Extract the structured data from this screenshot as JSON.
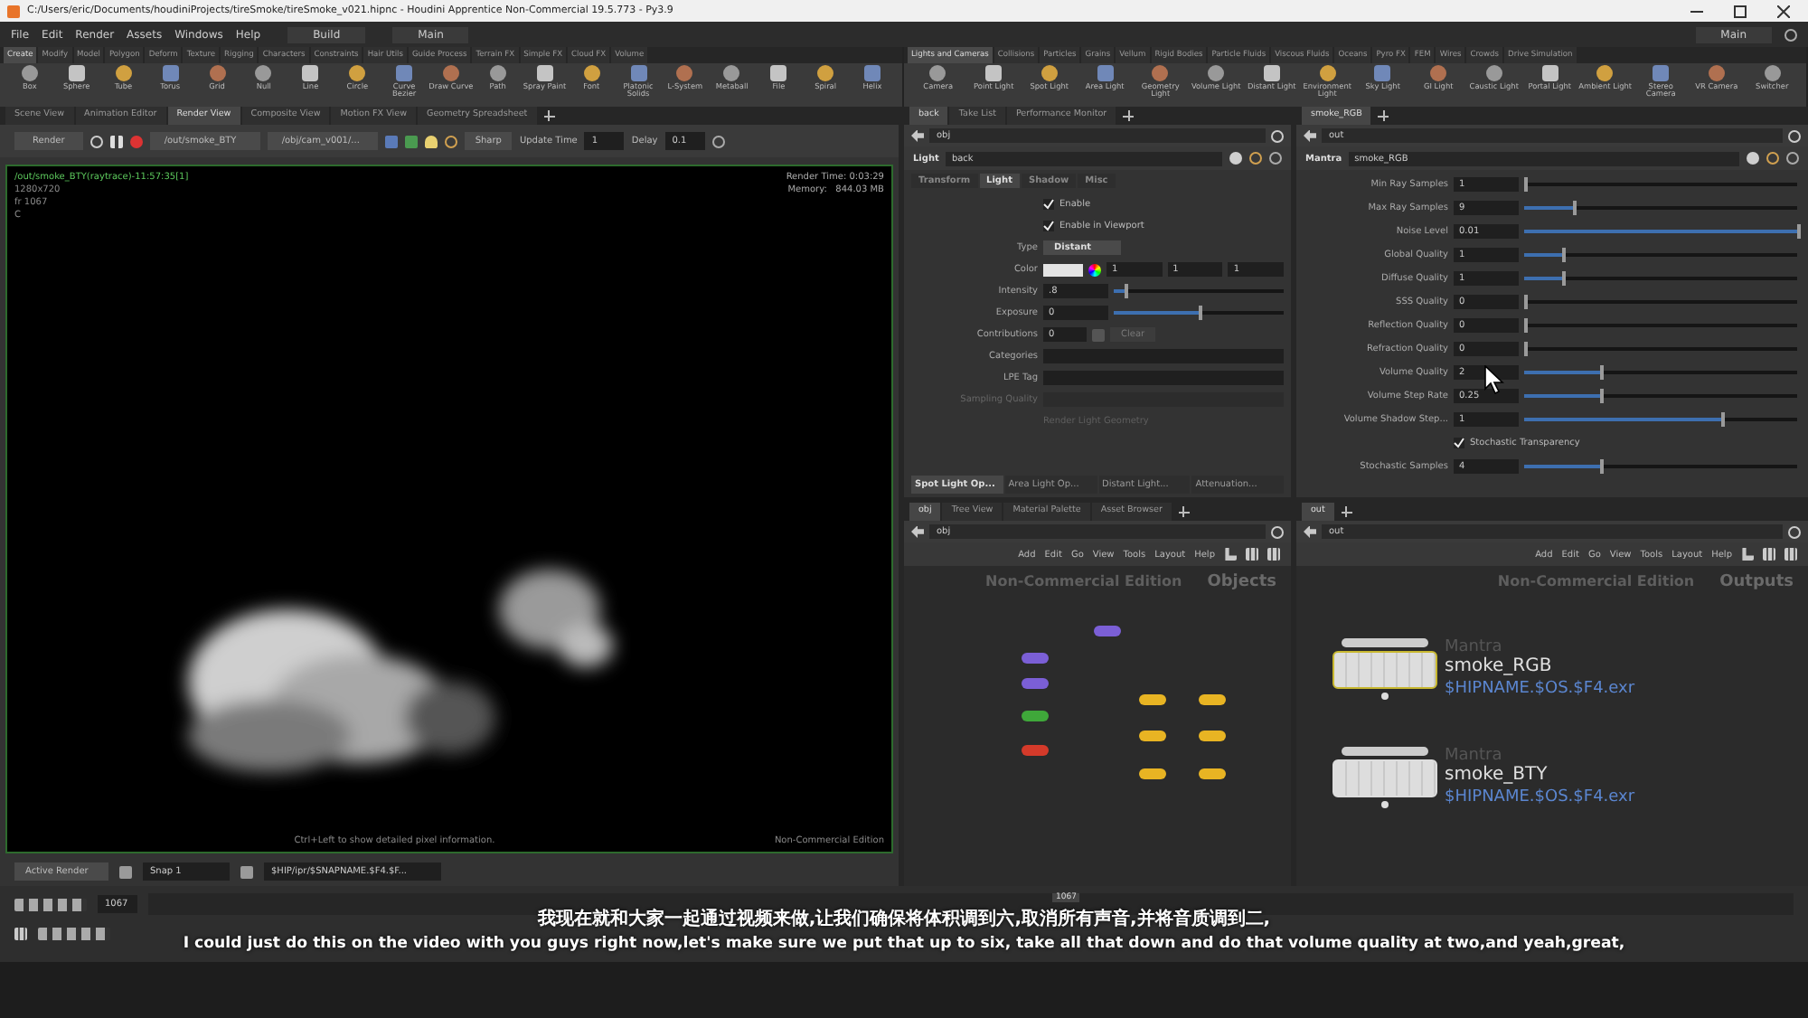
{
  "title_bar": {
    "title": "C:/Users/eric/Documents/houdiniProjects/tireSmoke/tireSmoke_v021.hipnc - Houdini Apprentice Non-Commercial 19.5.773 - Py3.9"
  },
  "menu_bar": {
    "items": [
      "File",
      "Edit",
      "Render",
      "Assets",
      "Windows",
      "Help"
    ],
    "desktop": "Build",
    "workspace": "Main",
    "right_workspace": "Main"
  },
  "shelves": [
    {
      "tabs": [
        {
          "label": "Create",
          "selected": true
        },
        {
          "label": "Modify",
          "selected": false
        },
        {
          "label": "Model",
          "selected": false
        },
        {
          "label": "Polygon",
          "selected": false
        },
        {
          "label": "Deform",
          "selected": false
        },
        {
          "label": "Texture",
          "selected": false
        },
        {
          "label": "Rigging",
          "selected": false
        },
        {
          "label": "Characters",
          "selected": false
        },
        {
          "label": "Constraints",
          "selected": false
        },
        {
          "label": "Hair Utils",
          "selected": false
        },
        {
          "label": "Guide Process",
          "selected": false
        },
        {
          "label": "Terrain FX",
          "selected": false
        },
        {
          "label": "Simple FX",
          "selected": false
        },
        {
          "label": "Cloud FX",
          "selected": false
        },
        {
          "label": "Volume",
          "selected": false
        }
      ],
      "tools": [
        "Box",
        "Sphere",
        "Tube",
        "Torus",
        "Grid",
        "Null",
        "Line",
        "Circle",
        "Curve Bezier",
        "Draw Curve",
        "Path",
        "Spray Paint",
        "Font",
        "Platonic Solids",
        "L-System",
        "Metaball",
        "File",
        "Spiral",
        "Helix"
      ]
    },
    {
      "tabs": [
        {
          "label": "Lights and Cameras",
          "selected": true
        },
        {
          "label": "Collisions",
          "selected": false
        },
        {
          "label": "Particles",
          "selected": false
        },
        {
          "label": "Grains",
          "selected": false
        },
        {
          "label": "Vellum",
          "selected": false
        },
        {
          "label": "Rigid Bodies",
          "selected": false
        },
        {
          "label": "Particle Fluids",
          "selected": false
        },
        {
          "label": "Viscous Fluids",
          "selected": false
        },
        {
          "label": "Oceans",
          "selected": false
        },
        {
          "label": "Pyro FX",
          "selected": false
        },
        {
          "label": "FEM",
          "selected": false
        },
        {
          "label": "Wires",
          "selected": false
        },
        {
          "label": "Crowds",
          "selected": false
        },
        {
          "label": "Drive Simulation",
          "selected": false
        }
      ],
      "tools": [
        "Camera",
        "Point Light",
        "Spot Light",
        "Area Light",
        "Geometry Light",
        "Volume Light",
        "Distant Light",
        "Environment Light",
        "Sky Light",
        "GI Light",
        "Caustic Light",
        "Portal Light",
        "Ambient Light",
        "Stereo Camera",
        "VR Camera",
        "Switcher"
      ]
    }
  ],
  "render_pane": {
    "tabs": [
      {
        "label": "Scene View",
        "selected": false
      },
      {
        "label": "Animation Editor",
        "selected": false
      },
      {
        "label": "Render View",
        "selected": true
      },
      {
        "label": "Composite View",
        "selected": false
      },
      {
        "label": "Motion FX View",
        "selected": false
      },
      {
        "label": "Geometry Spreadsheet",
        "selected": false
      }
    ],
    "toolbar": {
      "render_button": "Render",
      "rop": "/out/smoke_BTY",
      "camera": "/obj/cam_v001/...",
      "snap": "Sharp",
      "update_time_label": "Update Time",
      "update_time": "1",
      "delay_label": "Delay",
      "delay": "0.1"
    },
    "viewport": {
      "info": "/out/smoke_BTY(raytrace)-11:57:35[1]",
      "resolution": "1280x720",
      "frame": "fr 1067",
      "channel": "C",
      "render_time": "Render Time: 0:03:29",
      "memory": "Memory:   844.03 MB",
      "hint": "Ctrl+Left to show detailed pixel information.",
      "edition": "Non-Commercial Edition"
    },
    "status": {
      "active_render": "Active Render",
      "snap": "Snap 1",
      "path": "$HIP/ipr/$SNAPNAME.$F4.$F..."
    }
  },
  "light_pane": {
    "tabs": [
      {
        "label": "back",
        "selected": true
      },
      {
        "label": "Take List",
        "selected": false
      },
      {
        "label": "Performance Monitor",
        "selected": false
      }
    ],
    "path": "obj",
    "node_type": "Light",
    "node_name": "back",
    "param_tabs": [
      {
        "label": "Transform",
        "selected": false
      },
      {
        "label": "Light",
        "selected": true
      },
      {
        "label": "Shadow",
        "selected": false
      },
      {
        "label": "Misc",
        "selected": false
      }
    ],
    "params": [
      {
        "kind": "checkbox",
        "label": "Enable",
        "checked": true
      },
      {
        "kind": "checkbox",
        "label": "Enable in Viewport",
        "checked": true
      },
      {
        "kind": "menu",
        "label": "Type",
        "value": "Distant"
      },
      {
        "kind": "color",
        "label": "Color",
        "values": [
          "1",
          "1",
          "1"
        ]
      },
      {
        "kind": "slider",
        "label": "Intensity",
        "value": ".8",
        "level": 0.06
      },
      {
        "kind": "slider",
        "label": "Exposure",
        "value": "0",
        "level": 0.5
      },
      {
        "kind": "contrib",
        "label": "Contributions",
        "value": "0",
        "button": "Clear"
      },
      {
        "kind": "text",
        "label": "Categories",
        "disabled": false
      },
      {
        "kind": "text",
        "label": "LPE Tag",
        "disabled": false
      },
      {
        "kind": "text",
        "label": "Sampling Quality",
        "disabled": true
      },
      {
        "kind": "note",
        "label": "Render Light Geometry",
        "disabled": true
      }
    ],
    "bottom_tabs": [
      {
        "label": "Spot Light Op...",
        "selected": true
      },
      {
        "label": "Area Light Op...",
        "selected": false
      },
      {
        "label": "Distant Light...",
        "selected": false
      },
      {
        "label": "Attenuation...",
        "selected": false
      }
    ]
  },
  "mantra_pane": {
    "tabs": [
      {
        "label": "smoke_RGB",
        "selected": true
      }
    ],
    "path": "out",
    "node_type": "Mantra",
    "node_name": "smoke_RGB",
    "params": [
      {
        "kind": "slider",
        "label": "Min Ray Samples",
        "value": "1",
        "level": 0.0
      },
      {
        "kind": "slider",
        "label": "Max Ray Samples",
        "value": "9",
        "level": 0.18
      },
      {
        "kind": "slider",
        "label": "Noise Level",
        "value": "0.01",
        "level": 1.0
      },
      {
        "kind": "slider",
        "label": "Global Quality",
        "value": "1",
        "level": 0.14
      },
      {
        "kind": "slider",
        "label": "Diffuse Quality",
        "value": "1",
        "level": 0.14
      },
      {
        "kind": "slider",
        "label": "SSS Quality",
        "value": "0",
        "level": 0.0
      },
      {
        "kind": "slider",
        "label": "Reflection Quality",
        "value": "0",
        "level": 0.0
      },
      {
        "kind": "slider",
        "label": "Refraction Quality",
        "value": "0",
        "level": 0.0
      },
      {
        "kind": "slider",
        "label": "Volume Quality",
        "value": "2",
        "level": 0.28
      },
      {
        "kind": "slider",
        "label": "Volume Step Rate",
        "value": "0.25",
        "level": 0.28
      },
      {
        "kind": "slider",
        "label": "Volume Shadow Step...",
        "value": "1",
        "level": 0.72
      },
      {
        "kind": "checkbox",
        "label": "Stochastic Transparency",
        "checked": true
      },
      {
        "kind": "slider",
        "label": "Stochastic Samples",
        "value": "4",
        "level": 0.28
      }
    ]
  },
  "obj_network": {
    "tabs": [
      {
        "label": "obj",
        "selected": true
      },
      {
        "label": "Tree View",
        "selected": false
      },
      {
        "label": "Material Palette",
        "selected": false
      },
      {
        "label": "Asset Browser",
        "selected": false
      }
    ],
    "path": "obj",
    "menu": [
      "Add",
      "Edit",
      "Go",
      "View",
      "Tools",
      "Layout",
      "Help"
    ],
    "watermark": "Non-Commercial Edition",
    "context": "Objects",
    "nodes": [
      {
        "color": "#7b5fd6"
      },
      {
        "color": "#7b5fd6"
      },
      {
        "color": "#7b5fd6"
      },
      {
        "color": "#3fa83a"
      },
      {
        "color": "#d43a2a"
      },
      {
        "color": "#e8b423"
      },
      {
        "color": "#e8b423"
      },
      {
        "color": "#e8b423"
      },
      {
        "color": "#e8b423"
      },
      {
        "color": "#e8b423"
      },
      {
        "color": "#e8b423"
      }
    ]
  },
  "out_network": {
    "tabs": [
      {
        "label": "out",
        "selected": true
      }
    ],
    "path": "out",
    "menu": [
      "Add",
      "Edit",
      "Go",
      "View",
      "Tools",
      "Layout",
      "Help"
    ],
    "watermark": "Non-Commercial Edition",
    "context": "Outputs",
    "nodes": [
      {
        "type": "Mantra",
        "name": "smoke_RGB",
        "output": "$HIPNAME.$OS.$F4.exr",
        "selected": true
      },
      {
        "type": "Mantra",
        "name": "smoke_BTY",
        "output": "$HIPNAME.$OS.$F4.exr",
        "selected": false
      }
    ]
  },
  "timeline": {
    "frame": "1067",
    "marker": "1067"
  },
  "subtitles": {
    "chinese": "我现在就和大家一起通过视频来做,让我们确保将体积调到六,取消所有声音,并将音质调到二,",
    "english": "I could just do this on the video with you guys right now,let's make sure we put that up to six, take all that down and do that volume quality at two,and yeah,great,"
  }
}
